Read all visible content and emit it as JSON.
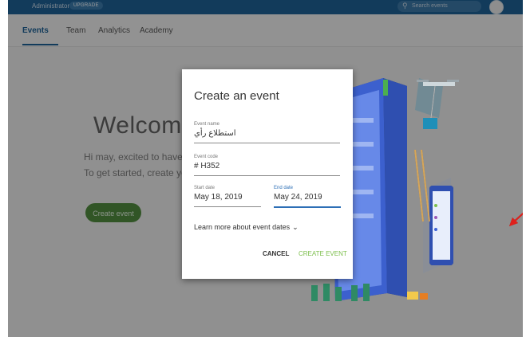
{
  "topbar": {
    "user_label": "Administrator",
    "upgrade_badge": "UPGRADE",
    "search_placeholder": "Search events"
  },
  "nav": {
    "tabs": [
      {
        "label": "Events",
        "active": true
      },
      {
        "label": "Team",
        "active": false
      },
      {
        "label": "Analytics",
        "active": false
      },
      {
        "label": "Academy",
        "active": false
      }
    ]
  },
  "page": {
    "welcome": "Welcome to",
    "intro_line1": "Hi may, excited to have you o",
    "intro_line2": "To get started, create your fir",
    "create_button": "Create event"
  },
  "dialog": {
    "title": "Create an event",
    "event_name": {
      "label": "Event name",
      "value": "استطلاع رأي"
    },
    "event_code": {
      "label": "Event code",
      "value": "# H352"
    },
    "start_date": {
      "label": "Start date",
      "value": "May 18, 2019"
    },
    "end_date": {
      "label": "End date",
      "value": "May 24, 2019"
    },
    "learn_more": "Learn more about event dates",
    "cancel_label": "CANCEL",
    "create_label": "CREATE EVENT"
  },
  "colors": {
    "topbar": "#1d5f93",
    "accent_green": "#7dbf4d",
    "focus_blue": "#2d6fb6",
    "annotation_red": "#e0211c"
  },
  "icons": [
    "search-icon",
    "avatar",
    "chevron-down-icon",
    "red-arrow-annotation"
  ]
}
